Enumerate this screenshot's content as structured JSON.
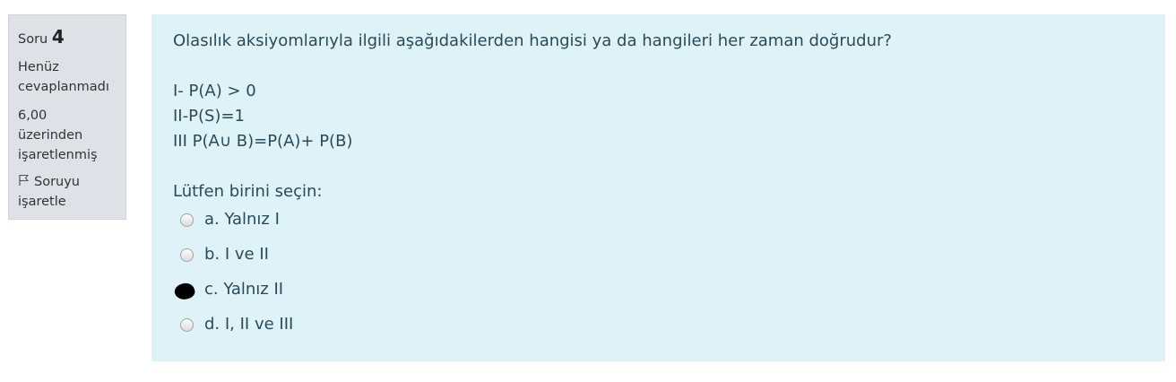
{
  "info": {
    "question_word": "Soru",
    "question_number": "4",
    "state_line1": "Henüz",
    "state_line2": "cevaplanmadı",
    "grade_line1": "6,00",
    "grade_line2": "üzerinden",
    "grade_line3": "işaretlenmiş",
    "flag_icon": "flag-icon",
    "flag_line1": "Soruyu",
    "flag_line2": "işaretle"
  },
  "question": {
    "text": "Olasılık aksiyomlarıyla ilgili aşağıdakilerden hangisi ya da hangileri her zaman doğrudur?",
    "statements": [
      "I- P(A) > 0",
      "II-P(S)=1",
      "III P(A∪ B)=P(A)+ P(B)"
    ],
    "prompt": "Lütfen birini seçin:",
    "answers": [
      {
        "label": "a. Yalnız I",
        "checked": false
      },
      {
        "label": "b. I ve II",
        "checked": false
      },
      {
        "label": "c. Yalnız II",
        "checked": true
      },
      {
        "label": "d. I, II ve III",
        "checked": false
      }
    ]
  }
}
